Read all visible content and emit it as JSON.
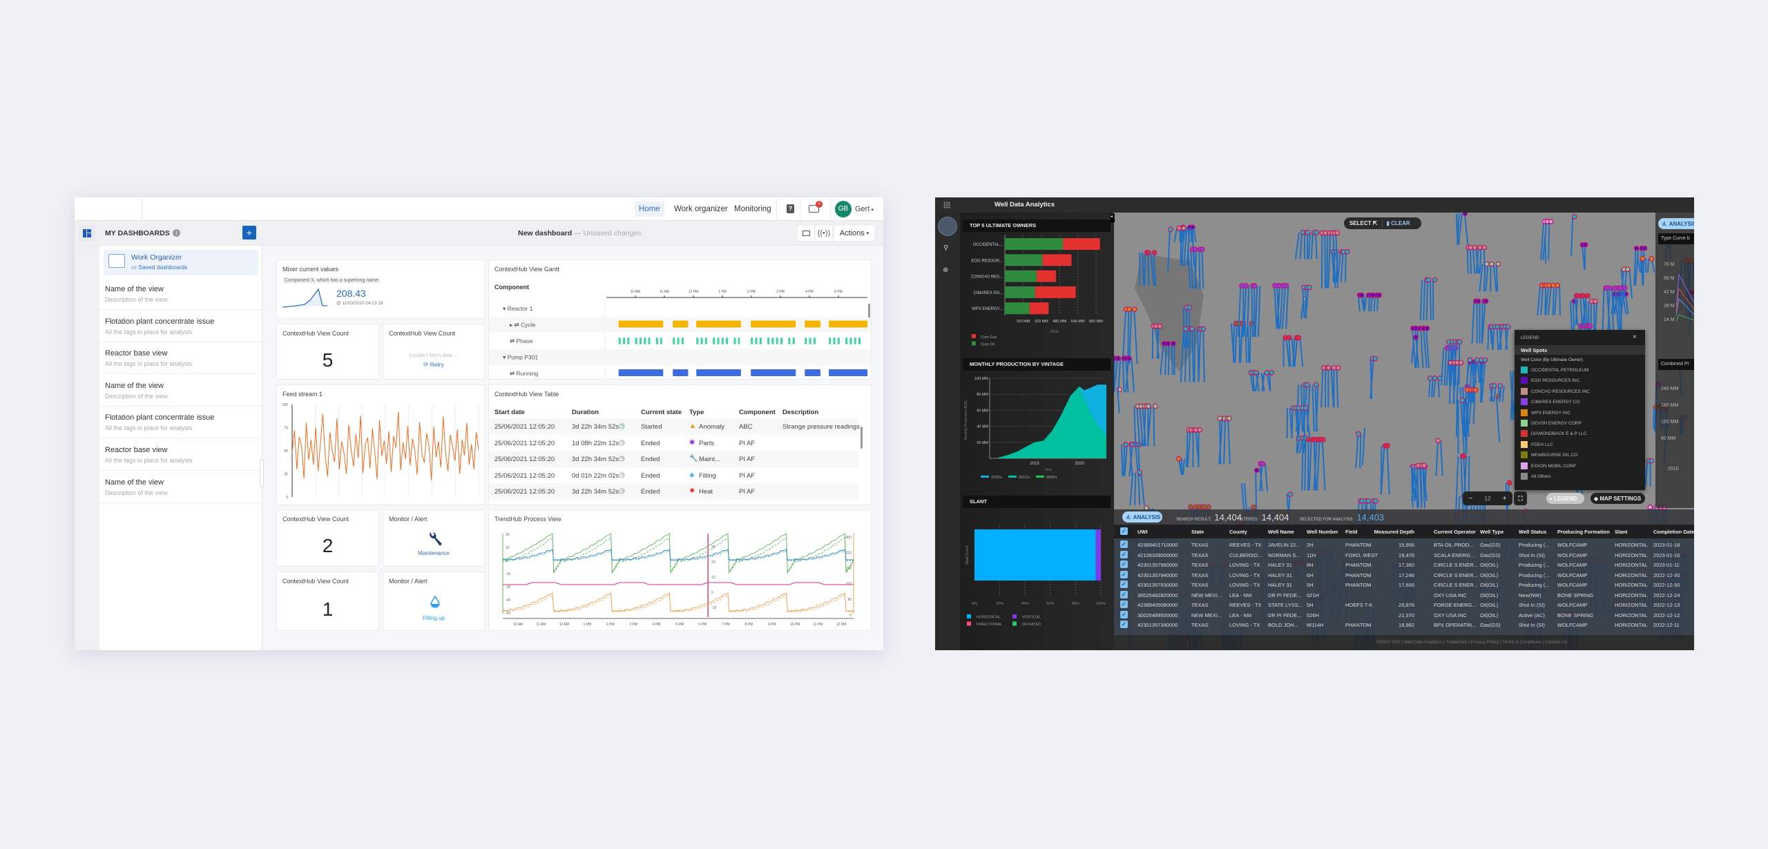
{
  "left_app": {
    "nav": {
      "items": [
        "Home",
        "Work organizer",
        "Monitoring"
      ],
      "active": "Home",
      "notification_count": "4",
      "avatar_initials": "GB",
      "user_name": "Gert"
    },
    "sidebar": {
      "title": "MY DASHBOARDS",
      "featured": {
        "title": "Work Organizer",
        "link": "Saved dashboards"
      },
      "items": [
        {
          "title": "Name of the view",
          "desc": "Description of the view"
        },
        {
          "title": "Flotation plant concentrate issue",
          "desc": "All the tags in place for analysis"
        },
        {
          "title": "Reactor base view",
          "desc": "All the tags in place for analysis"
        },
        {
          "title": "Name of the view",
          "desc": "Description of the view"
        },
        {
          "title": "Flotation plant concentrate issue",
          "desc": "All the tags in place for analysis"
        },
        {
          "title": "Reactor base view",
          "desc": "All the tags in place for analysis"
        },
        {
          "title": "Name of the view",
          "desc": "Description of the view"
        }
      ]
    },
    "toolbar": {
      "dashboard_name": "New dashboard",
      "status": "— Unsaved changes",
      "actions_label": "Actions"
    },
    "widgets": {
      "mixer": {
        "title": "Mixer current values",
        "component": "Component X, which has a superlong name",
        "value": "208.43",
        "timestamp": "@ 11/03/2020 04:23:19"
      },
      "count_a": {
        "title": "ContextHub View Count",
        "value": "5"
      },
      "count_b": {
        "title": "ContextHub View Count",
        "error": "Couldn't fetch data ...",
        "retry": "Retry"
      },
      "feed": {
        "title": "Feed stream 1",
        "y_ticks": [
          "100",
          "75",
          "50",
          "25",
          "0"
        ],
        "values": [
          48,
          72,
          30,
          65,
          55,
          20,
          80,
          40,
          62,
          35,
          75,
          28,
          58,
          90,
          45,
          22,
          70,
          50,
          38,
          85,
          30,
          60,
          47,
          25,
          78,
          52,
          33,
          68,
          42,
          88,
          26,
          57,
          64,
          31,
          74,
          49,
          19,
          83,
          44,
          61,
          36,
          71,
          27,
          66,
          53,
          92,
          29,
          59,
          41,
          77,
          34,
          63,
          50,
          24,
          81,
          46,
          37,
          69,
          55,
          18,
          76,
          43,
          60,
          32,
          87,
          48,
          28,
          67,
          54,
          39,
          73,
          25,
          62,
          45,
          80,
          35,
          57,
          30,
          70,
          51
        ]
      },
      "gantt": {
        "title": "ContextHub View Gantt",
        "column": "Component",
        "x_ticks": [
          "10 AM",
          "11 AM",
          "12 PM",
          "1 PM",
          "2 PM",
          "3 PM",
          "4 PM",
          "5 PM"
        ],
        "hour_range": [
          9,
          18
        ],
        "rows": [
          {
            "label": "Reactor 1",
            "kind": "group"
          },
          {
            "label": "Cycle",
            "kind": "cycle",
            "color": "#f5b400"
          },
          {
            "label": "Phase",
            "kind": "phase",
            "color": "#3dd6a3"
          },
          {
            "label": "Pump P301",
            "kind": "group"
          },
          {
            "label": "Running",
            "kind": "running",
            "color": "#3d6be0"
          }
        ],
        "segments": [
          [
            9.42,
            10.96
          ],
          [
            11.29,
            11.82
          ],
          [
            12.1,
            13.64
          ],
          [
            13.98,
            15.53
          ],
          [
            15.84,
            16.38
          ],
          [
            16.67,
            18
          ]
        ]
      },
      "table": {
        "title": "ContextHub View Table",
        "columns": [
          "Start date",
          "Duration",
          "Current state",
          "Type",
          "Component",
          "Description"
        ],
        "rows": [
          [
            "25/06/2021 12:05:20",
            "3d 22h 34m 52s",
            "Started",
            "Anomaly",
            "ABC",
            "Strange pressure readings"
          ],
          [
            "25/06/2021 12:05:20",
            "1d 08h 22m 12s",
            "Ended",
            "Parts",
            "PI AF",
            ""
          ],
          [
            "25/06/2021 12:05:20",
            "3d 22h 34m 52s",
            "Ended",
            "Maint...",
            "PI AF",
            ""
          ],
          [
            "25/06/2021 12:05:20",
            "0d 01h 22m 02s",
            "Ended",
            "Filling",
            "PI AF",
            ""
          ],
          [
            "25/06/2021 12:05:20",
            "3d 22h 34m 52s",
            "Ended",
            "Heat",
            "PI AF",
            ""
          ]
        ],
        "type_icons": [
          {
            "icon": "warning-icon",
            "color": "#f08c00"
          },
          {
            "icon": "puzzle-icon",
            "color": "#8a2be2"
          },
          {
            "icon": "wrench-icon",
            "color": "#1f3d6b"
          },
          {
            "icon": "drop-icon",
            "color": "#2a9df4"
          },
          {
            "icon": "heat-icon",
            "color": "#e53935"
          }
        ]
      },
      "count_c": {
        "title": "ContextHub View Count",
        "value": "2"
      },
      "alert_a": {
        "title": "Monitor / Alert",
        "label": "Maintenance"
      },
      "count_d": {
        "title": "ContextHub View Count",
        "value": "1"
      },
      "alert_b": {
        "title": "Monitor / Alert",
        "label": "Filling up"
      },
      "trend": {
        "title": "TrendHub Process View",
        "y_left": [
          "30",
          "15",
          "0",
          "-15",
          "-30",
          "-45",
          "-60"
        ],
        "y_mid": [
          "30",
          "20",
          "10",
          "0",
          "-10"
        ],
        "y_right": [
          "400",
          "320",
          "240",
          "160",
          "80",
          "0"
        ],
        "x_ticks": [
          "10 AM",
          "11 AM",
          "12 AM",
          "1 PM",
          "2 PM",
          "3 PM",
          "4 PM",
          "5 PM",
          "6 PM",
          "7 PM",
          "8 PM",
          "9 PM",
          "10 PM",
          "11 PM",
          "12 PM"
        ],
        "colors": {
          "green": "#5cb85c",
          "blue": "#3b8fc4",
          "pink": "#d6338a",
          "orange": "#f0a050",
          "cursor": "#c2185b"
        }
      }
    }
  },
  "right_app": {
    "title": "Well Data Analytics",
    "top_owners": {
      "title": "TOP 5 ULTIMATE OWNERS",
      "xlabel": "BOE",
      "x_ticks": [
        "160 MM",
        "320 MM",
        "480 MM",
        "640 MM",
        "800 MM"
      ],
      "categories": [
        "OCCIDENTAL...",
        "EOG RESOUR...",
        "CONCHO RES...",
        "CIMAREX EN...",
        "WPX ENERGY..."
      ],
      "series": [
        {
          "name": "Cum Oil",
          "color": "#2e8b3e",
          "values": [
            509,
            330,
            279,
            265,
            217
          ]
        },
        {
          "name": "Cum Gas",
          "color": "#e53030",
          "values": [
            326,
            255,
            170,
            357,
            167
          ]
        }
      ],
      "legend": [
        "Cum Gas",
        "Cum Oil"
      ]
    },
    "monthly": {
      "title": "MONTHLY PRODUCTION BY VINTAGE",
      "ylabel": "Monthly Production (BOE)",
      "xlabel": "Year",
      "y_ticks": [
        "100 MM",
        "80 MM",
        "60 MM",
        "40 MM",
        "20 MM"
      ],
      "x_ticks": [
        "2015",
        "2020"
      ],
      "ylim": [
        0,
        100
      ],
      "xlim": [
        2010,
        2023
      ],
      "x": [
        2011,
        2012,
        2013,
        2014,
        2015,
        2016,
        2017,
        2018,
        2019,
        2020,
        2020.5,
        2021,
        2022,
        2023
      ],
      "series": [
        {
          "name": "2010's",
          "color": "#00c0a0",
          "values": [
            1,
            4,
            8,
            14,
            20,
            22,
            35,
            55,
            78,
            90,
            75,
            62,
            42,
            30
          ]
        },
        {
          "name": "2020's",
          "color": "#10b0e0",
          "values": [
            0,
            0,
            0,
            0,
            0,
            0,
            0,
            0,
            0,
            0,
            10,
            25,
            50,
            62
          ]
        },
        {
          "name": "2000's",
          "color": "#22c55e",
          "values": []
        }
      ]
    },
    "slant": {
      "title": "SLANT",
      "ylabel": "Well Count",
      "x_ticks": [
        "0%",
        "20%",
        "40%",
        "60%",
        "80%",
        "100%"
      ],
      "values": [
        {
          "name": "HORIZONTAL",
          "color": "#00b0ff",
          "pct": 96
        },
        {
          "name": "VERTICAL",
          "color": "#7c3aed",
          "pct": 4
        },
        {
          "name": "DIRECTIONAL",
          "color": "#ff4d7d",
          "pct": 0
        },
        {
          "name": "DEVIATED",
          "color": "#22d36b",
          "pct": 0
        }
      ]
    },
    "map": {
      "select_label": "SELECT",
      "clear_label": "CLEAR",
      "zoom_level": "12",
      "legend_button": "LEGEND",
      "map_settings": "MAP SETTINGS",
      "bg": "#8e8e8e",
      "stick_color": "#1c6fc4",
      "ring_color": "#c2186b"
    },
    "legend": {
      "title": "LEGEND",
      "section": "Well Spots",
      "subtitle": "Well Color (By Ultimate Owner)",
      "items": [
        {
          "name": "OCCIDENTAL PETROLEUM",
          "color": "#1fb5b9"
        },
        {
          "name": "EOG RESOURCES INC",
          "color": "#5b0fb5"
        },
        {
          "name": "CONCHO RESOURCES INC",
          "color": "#c28c88"
        },
        {
          "name": "CIMAREX ENERGY CO",
          "color": "#8d3fe6"
        },
        {
          "name": "WPX ENERGY INC",
          "color": "#d9850f"
        },
        {
          "name": "DEVON ENERGY CORP",
          "color": "#8fd08a"
        },
        {
          "name": "DIAMONDBACK E & P LLC",
          "color": "#d33333"
        },
        {
          "name": "PDEH LLC",
          "color": "#ffc878"
        },
        {
          "name": "MEWBOURNE OIL CO",
          "color": "#7b7b0e"
        },
        {
          "name": "EXXON MOBIL CORP",
          "color": "#dba3ea"
        },
        {
          "name": "All Others",
          "color": "#8a8a8a"
        }
      ]
    },
    "right_panel": {
      "analysis": "ANALYSIS",
      "type_curve": "Type Curve b",
      "tc_ticks": [
        "70 M",
        "56 M",
        "42 M",
        "28 M",
        "14 M"
      ],
      "combined": "Combined Pr",
      "cp_ticks": [
        "240 MM",
        "180 MM",
        "120 MM",
        "60 MM"
      ],
      "cp_x": "2010"
    },
    "analysis_bar": {
      "button": "ANALYSIS",
      "search_label": "SEARCH RESULT:",
      "search_value": "14,404",
      "filtered_label": "FILTERED:",
      "filtered_value": "14,404",
      "selected_label": "SELECTED FOR ANALYSIS:",
      "selected_value": "14,403"
    },
    "table": {
      "columns": [
        "UWI",
        "State",
        "County",
        "Well Name",
        "Well Number",
        "Field",
        "Measured Depth",
        "Current Operator",
        "Well Type",
        "Well Status",
        "Producing Formation",
        "Slant",
        "Completion Date"
      ],
      "rows": [
        [
          "42389401710000",
          "TEXAS",
          "REEVES - TX",
          "JAVELIN 22...",
          "2H",
          "PHANTOM",
          "15,956",
          "BTA OIL PROD...",
          "Gas(GS)",
          "Producing (...",
          "WOLFCAMP",
          "HORIZONTAL",
          "2023-01-18"
        ],
        [
          "42109339000000",
          "TEXAS",
          "CULBERSO...",
          "NORMAN S...",
          "11H",
          "FORD, WEST",
          "19,476",
          "SCALA ENERG...",
          "Gas(GS)",
          "Shut In (SI)",
          "WOLFCAMP",
          "HORIZONTAL",
          "2023-01-16"
        ],
        [
          "42301357960000",
          "TEXAS",
          "LOVING - TX",
          "HALEY 31",
          "8H",
          "PHANTOM",
          "17,360",
          "CIRCLE S ENER...",
          "Oil(OIL)",
          "Producing (...",
          "WOLFCAMP",
          "HORIZONTAL",
          "2023-01-11"
        ],
        [
          "42301357940000",
          "TEXAS",
          "LOVING - TX",
          "HALEY 31",
          "6H",
          "PHANTOM",
          "17,246",
          "CIRCLE S ENER...",
          "Oil(OIL)",
          "Producing (...",
          "WOLFCAMP",
          "HORIZONTAL",
          "2022-12-30"
        ],
        [
          "42301357930000",
          "TEXAS",
          "LOVING - TX",
          "HALEY 31",
          "5H",
          "PHANTOM",
          "17,600",
          "CIRCLE S ENER...",
          "Oil(OIL)",
          "Producing (...",
          "WOLFCAMP",
          "HORIZONTAL",
          "2022-12-30"
        ],
        [
          "30025482820000",
          "NEW MEXI...",
          "LEA - NM",
          "DR PI FEDE...",
          "021H",
          "",
          "",
          "OXY USA INC",
          "Oil(OIL)",
          "New(NW)",
          "BONE SPRING",
          "HORIZONTAL",
          "2022-12-24"
        ],
        [
          "42389400080000",
          "TEXAS",
          "REEVES - TX",
          "STATE LYSS...",
          "5H",
          "HOEFS T-K",
          "20,876",
          "FORGE ENERG...",
          "Oil(OIL)",
          "Shut In (SI)",
          "WOLFCAMP",
          "HORIZONTAL",
          "2022-12-13"
        ],
        [
          "30025489500000",
          "NEW MEXI...",
          "LEA - NM",
          "DR PI FEDE...",
          "026H",
          "",
          "21,370",
          "OXY USA INC",
          "Oil(OIL)",
          "Active (AC)",
          "BONE SPRING",
          "HORIZONTAL",
          "2022-12-12"
        ],
        [
          "42301357340000",
          "TEXAS",
          "LOVING - TX",
          "BOLD JOH...",
          "W114H",
          "PHANTOM",
          "18,982",
          "BPX OPERATIN...",
          "Gas(GS)",
          "Shut In (SI)",
          "WOLFCAMP",
          "HORIZONTAL",
          "2022-12-11"
        ]
      ]
    },
    "footer": "©2023 TGS | Well Data Analytics | Trademark | Privacy Policy | Terms & Conditions | Contact Us"
  }
}
